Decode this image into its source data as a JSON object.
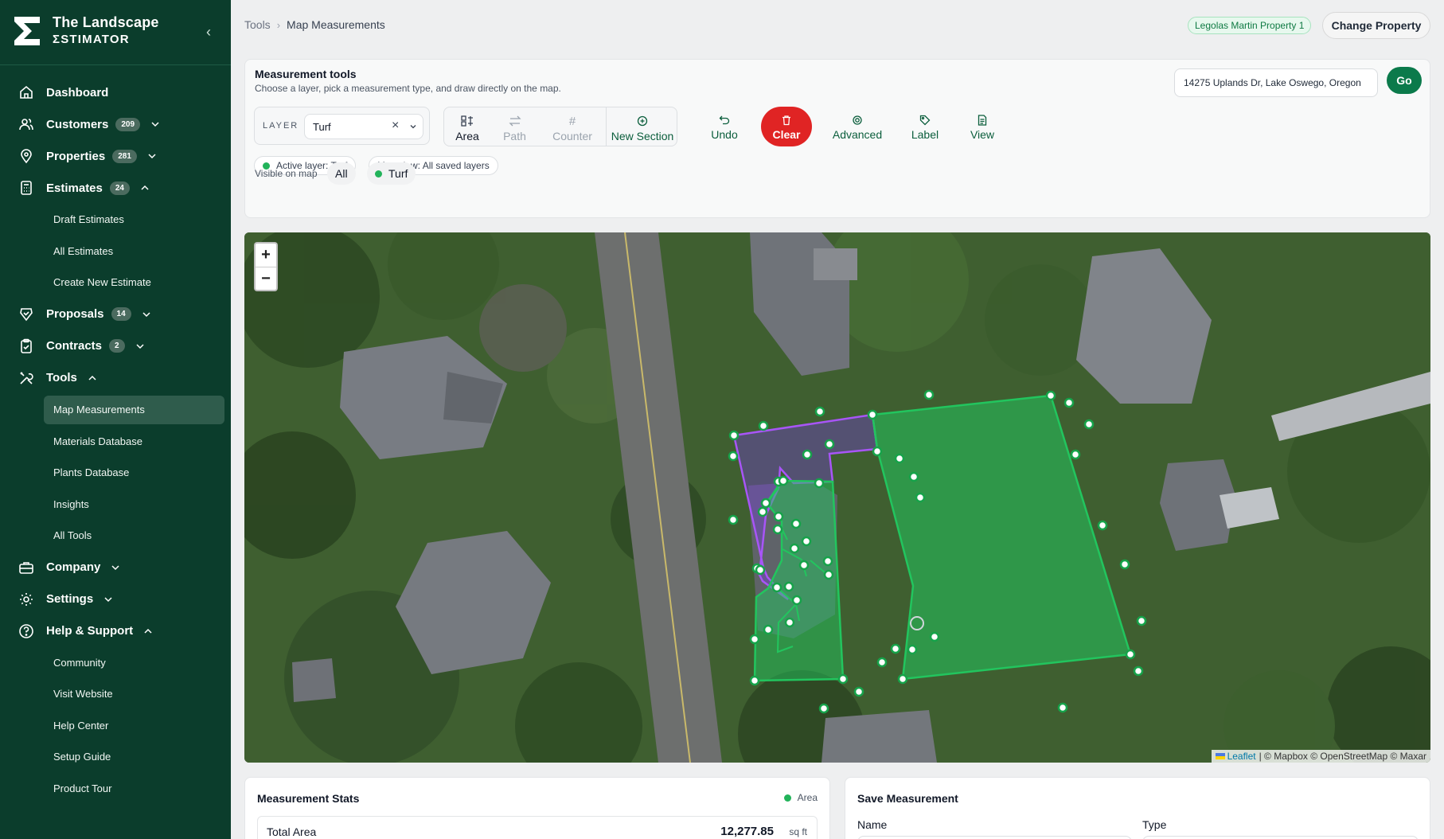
{
  "brand": {
    "line1": "The Landscape",
    "line2": "ΣSTIMATOR"
  },
  "nav": {
    "dashboard": "Dashboard",
    "customers": "Customers",
    "customers_count": "209",
    "properties": "Properties",
    "properties_count": "281",
    "estimates": "Estimates",
    "estimates_count": "24",
    "estimates_sub": [
      "Draft Estimates",
      "All Estimates",
      "Create New Estimate"
    ],
    "proposals": "Proposals",
    "proposals_count": "14",
    "contracts": "Contracts",
    "contracts_count": "2",
    "tools": "Tools",
    "tools_sub": [
      "Map Measurements",
      "Materials Database",
      "Plants Database",
      "Insights",
      "All Tools"
    ],
    "company": "Company",
    "settings": "Settings",
    "help": "Help & Support",
    "help_sub": [
      "Community",
      "Visit Website",
      "Help Center",
      "Setup Guide",
      "Product Tour"
    ]
  },
  "breadcrumb": {
    "parent": "Tools",
    "current": "Map Measurements"
  },
  "property": {
    "badge": "Legolas Martin Property 1",
    "change_label": "Change Property"
  },
  "tools": {
    "title": "Measurement tools",
    "subtitle": "Choose a layer, pick a measurement type, and draw directly on the map.",
    "address": "14275 Uplands Dr, Lake Oswego, Oregon",
    "go_label": "Go",
    "layer_label": "LAYER",
    "layer_value": "Turf",
    "area_label": "Area",
    "path_label": "Path",
    "counter_label": "Counter",
    "new_section_label": "New Section",
    "undo_label": "Undo",
    "clear_label": "Clear",
    "advanced_label": "Advanced",
    "label_label": "Label",
    "view_label": "View",
    "active_layer_chip": "Active layer: Turf",
    "map_view_chip": "Map view: All saved layers",
    "visible_label": "Visible on map",
    "visible_all": "All",
    "visible_turf": "Turf"
  },
  "map": {
    "zoom_in": "+",
    "zoom_out": "−",
    "attribution_link": "Leaflet",
    "attribution_text": "| © Mapbox © OpenStreetMap © Maxar"
  },
  "stats": {
    "title": "Measurement Stats",
    "tag": "Area",
    "total_label": "Total Area",
    "total_value": "12,277.85",
    "total_unit": "sq ft"
  },
  "save": {
    "title": "Save Measurement",
    "name_label": "Name",
    "type_label": "Type"
  },
  "colors": {
    "sidebar": "#0b3d2c",
    "accent_green": "#0b7a4b",
    "clear_red": "#e02424",
    "turf_polygon": "#22c55e",
    "purple_polygon": "#9b5de5"
  }
}
